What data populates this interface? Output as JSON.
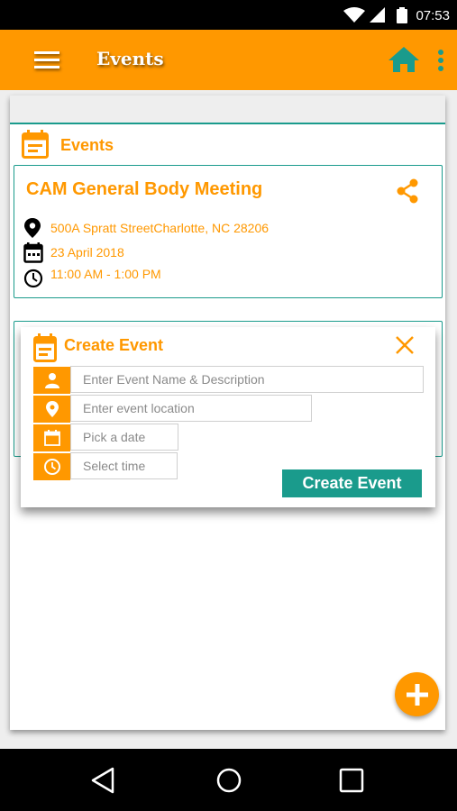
{
  "status_bar": {
    "time": "07:53"
  },
  "app_bar": {
    "title": "Events"
  },
  "events_section": {
    "heading": "Events"
  },
  "event": {
    "title": "CAM General Body Meeting",
    "location": "500A Spratt StreetCharlotte, NC 28206",
    "date": "23 April 2018",
    "time": "11:00 AM - 1:00 PM"
  },
  "dialog": {
    "title": "Create Event",
    "name_placeholder": "Enter Event Name & Description",
    "location_placeholder": "Enter event location",
    "date_placeholder": "Pick a date",
    "time_placeholder": "Select time",
    "submit_label": "Create Event"
  },
  "colors": {
    "primary": "#ff9800",
    "accent": "#1a9b8c"
  },
  "icons": [
    "menu-icon",
    "home-icon",
    "more-vert-icon",
    "calendar-icon",
    "share-icon",
    "location-pin-icon",
    "clock-icon",
    "close-icon",
    "person-icon",
    "plus-icon",
    "back-icon",
    "circle-home-icon",
    "square-recents-icon"
  ]
}
